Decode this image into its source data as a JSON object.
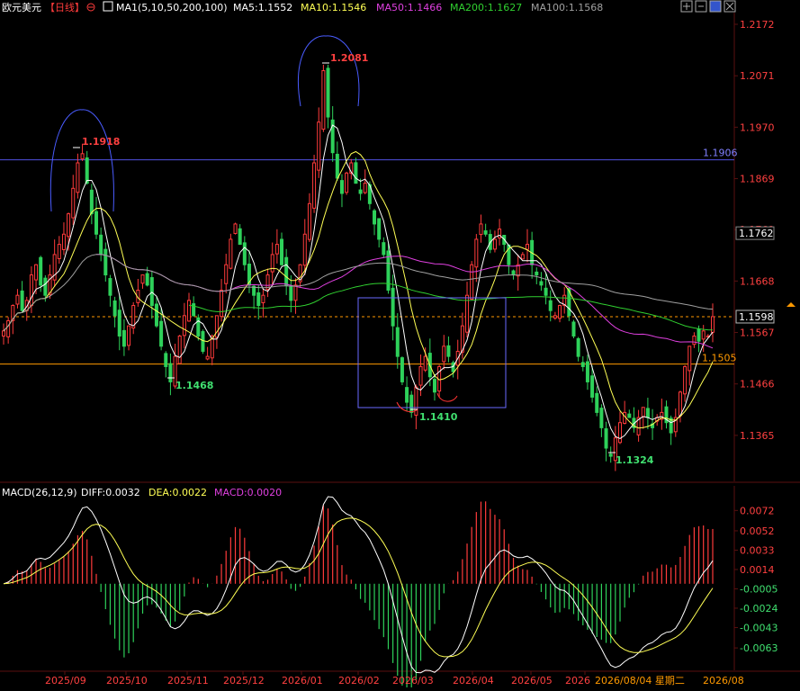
{
  "header": {
    "name": "欧元美元",
    "period": "【日线】",
    "ma_indicator": "MA1(5,10,50,200,100)",
    "ma_values": [
      {
        "label": "MA5:1.1552",
        "color": "#ffffff"
      },
      {
        "label": "MA10:1.1546",
        "color": "#ffff55"
      },
      {
        "label": "MA50:1.1466",
        "color": "#e040e0"
      },
      {
        "label": "MA200:1.1627",
        "color": "#30d030"
      },
      {
        "label": "MA100:1.1568",
        "color": "#a0a0a0"
      }
    ]
  },
  "price_axis": {
    "ticks": [
      "1.2172",
      "1.2071",
      "1.1970",
      "1.1869",
      "1.1769",
      "1.1668",
      "1.1567",
      "1.1466",
      "1.1365"
    ],
    "ymin": 1.128,
    "ymax": 1.2195
  },
  "macd_header": {
    "title": "MACD(26,12,9)",
    "diff": "DIFF:0.0032",
    "dea": "DEA:0.0022",
    "macd": "MACD:0.0020"
  },
  "macd_axis": {
    "ticks": [
      "0.0072",
      "0.0052",
      "0.0033",
      "0.0014",
      "-0.0005",
      "-0.0024",
      "-0.0043",
      "-0.0063"
    ],
    "ymin": -0.0085,
    "ymax": 0.0082
  },
  "x_axis": {
    "labels": [
      "2025/09",
      "2025/10",
      "2025/11",
      "2025/12",
      "2026/01",
      "2026/02",
      "2026/03",
      "2026/04",
      "2026/05",
      "2026"
    ],
    "cursor_label": "2026/08/04 星期二",
    "end_label": "2026/08"
  },
  "annotations": {
    "high1": "1.1918",
    "high2": "1.2081",
    "low1": "1.1468",
    "low2": "1.1410",
    "low3": "1.1324",
    "resistance": "1.1906",
    "support": "1.1505",
    "current": "1.1598",
    "crosshair": "1.1762"
  },
  "colors": {
    "up": "#ff3b3b",
    "down": "#2ed15a",
    "ma5": "#ffffff",
    "ma10": "#ffff55",
    "ma50": "#e040e0",
    "ma200": "#30d030",
    "ma100": "#a0a0a0",
    "blue_line": "#6060ff",
    "orange_line": "#ff9900"
  },
  "chart_data": {
    "type": "candlestick",
    "symbol": "欧元美元",
    "period": "【日线】",
    "date_range": [
      "2025/09",
      "2026/08"
    ],
    "key_levels": {
      "resistance": 1.1906,
      "support": 1.1505,
      "last": 1.1598
    },
    "swing_points": [
      {
        "label": "1.1918",
        "value": 1.1918,
        "type": "high"
      },
      {
        "label": "1.1468",
        "value": 1.1468,
        "type": "low"
      },
      {
        "label": "1.2081",
        "value": 1.2081,
        "type": "high"
      },
      {
        "label": "1.1410",
        "value": 1.141,
        "type": "low"
      },
      {
        "label": "1.1324",
        "value": 1.1324,
        "type": "low"
      }
    ],
    "close_path": [
      1.157,
      1.159,
      1.162,
      1.164,
      1.161,
      1.163,
      1.168,
      1.17,
      1.166,
      1.164,
      1.168,
      1.172,
      1.174,
      1.176,
      1.18,
      1.185,
      1.19,
      1.1918,
      1.186,
      1.18,
      1.176,
      1.172,
      1.168,
      1.164,
      1.16,
      1.156,
      1.154,
      1.158,
      1.162,
      1.165,
      1.168,
      1.166,
      1.162,
      1.158,
      1.154,
      1.15,
      1.147,
      1.152,
      1.156,
      1.16,
      1.163,
      1.16,
      1.156,
      1.153,
      1.152,
      1.156,
      1.16,
      1.165,
      1.17,
      1.175,
      1.178,
      1.174,
      1.17,
      1.166,
      1.164,
      1.162,
      1.164,
      1.168,
      1.172,
      1.174,
      1.17,
      1.166,
      1.163,
      1.166,
      1.17,
      1.176,
      1.182,
      1.19,
      1.198,
      1.2081,
      1.199,
      1.192,
      1.187,
      1.184,
      1.188,
      1.19,
      1.186,
      1.184,
      1.186,
      1.182,
      1.178,
      1.175,
      1.172,
      1.165,
      1.158,
      1.152,
      1.147,
      1.143,
      1.141,
      1.146,
      1.15,
      1.152,
      1.148,
      1.145,
      1.15,
      1.154,
      1.152,
      1.149,
      1.153,
      1.158,
      1.164,
      1.17,
      1.175,
      1.178,
      1.176,
      1.173,
      1.175,
      1.177,
      1.174,
      1.17,
      1.168,
      1.17,
      1.172,
      1.174,
      1.17,
      1.168,
      1.166,
      1.164,
      1.161,
      1.16,
      1.162,
      1.164,
      1.16,
      1.156,
      1.152,
      1.15,
      1.147,
      1.144,
      1.141,
      1.138,
      1.134,
      1.1324,
      1.136,
      1.139,
      1.141,
      1.14,
      1.138,
      1.14,
      1.142,
      1.14,
      1.138,
      1.14,
      1.141,
      1.139,
      1.137,
      1.14,
      1.145,
      1.15,
      1.154,
      1.156,
      1.155,
      1.157,
      1.156,
      1.1598
    ],
    "macd_series": {
      "diff": "0.0032",
      "dea": "0.0022",
      "macd": "0.0020"
    }
  }
}
